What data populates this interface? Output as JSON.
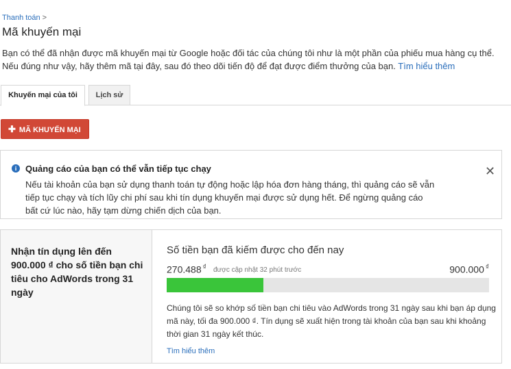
{
  "breadcrumb": {
    "label": "Thanh toán",
    "separator": ">"
  },
  "page_title": "Mã khuyến mại",
  "intro": {
    "line1": "Bạn có thể đã nhận được mã khuyến mại từ Google hoặc đối tác của chúng tôi như là một phần của phiếu mua hàng cụ thể.",
    "line2": "Nếu đúng như vậy, hãy thêm mã tại đây, sau đó theo dõi tiến độ để đạt được điểm thưởng của bạn.",
    "link": "Tìm hiểu thêm"
  },
  "tabs": [
    {
      "label": "Khuyến mại của tôi",
      "active": true
    },
    {
      "label": "Lịch sử",
      "active": false
    }
  ],
  "add_button": {
    "icon": "plus-icon",
    "label": "MÃ KHUYẾN MẠI"
  },
  "notice": {
    "icon": "info-icon",
    "title": "Quảng cáo của bạn có thể vẫn tiếp tục chạy",
    "line1": "Nếu tài khoản của bạn sử dụng thanh toán tự động hoặc lập hóa đơn hàng tháng, thì quảng cáo sẽ vẫn",
    "line2": "tiếp tục chạy và tích lũy chi phí sau khi tín dụng khuyến mại được sử dụng hết. Để ngừng quảng cáo",
    "line3": "bất cứ lúc nào, hãy tạm dừng chiến dịch của bạn.",
    "close_icon": "close-icon"
  },
  "promo_card": {
    "title": "Nhận tín dụng lên đến 900.000 ₫ cho số tiền bạn chi tiêu cho AdWords trong 31 ngày",
    "earned_title": "Số tiền bạn đã kiếm được cho đến nay",
    "current_amount": "270.488",
    "currency": "₫",
    "updated_text": "được cập nhật 32 phút trước",
    "max_amount": "900.000",
    "progress_fraction": 0.3005,
    "progress_color": "#3ac53a",
    "description": "Chúng tôi sẽ so khớp số tiền bạn chi tiêu vào AdWords trong 31 ngày sau khi bạn áp dụng mã này, tối đa 900.000 ₫. Tín dụng sẽ xuất hiện trong tài khoản của bạn sau khi khoảng thời gian 31 ngày kết thúc.",
    "learn_more": "Tìm hiểu thêm"
  },
  "colors": {
    "link": "#2a6ebb",
    "button": "#d14836"
  }
}
